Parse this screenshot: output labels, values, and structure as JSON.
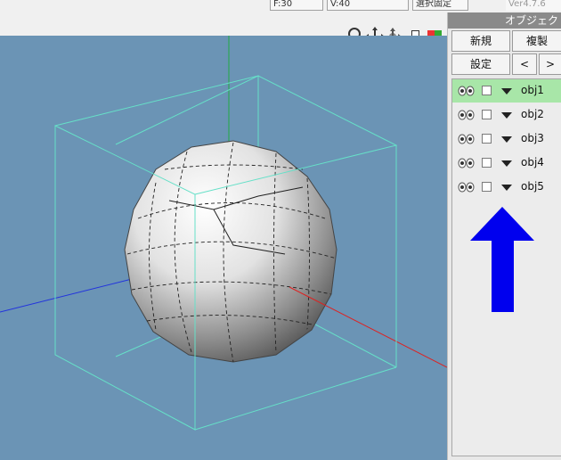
{
  "topbar": {
    "f_field": "F:30",
    "v_field": "V:40",
    "lock_button": "選択固定",
    "version": "Ver4.7.6"
  },
  "toolbar": {
    "icons": [
      "zoom-icon",
      "move-icon",
      "rotate-icon",
      "view-layout-icon",
      "color-palette-icon"
    ]
  },
  "viewport": {
    "background": "#6b94b5",
    "bounding_box_color": "#66e0c8",
    "axis_colors": {
      "x": "#dd2222",
      "y": "#22aa44",
      "z": "#2233dd"
    }
  },
  "panel": {
    "title": "オブジェクト",
    "new_label": "新規",
    "duplicate_label": "複製",
    "settings_label": "設定",
    "prev_label": "<",
    "next_label": ">",
    "objects": [
      {
        "name": "obj1",
        "selected": true
      },
      {
        "name": "obj2",
        "selected": false
      },
      {
        "name": "obj3",
        "selected": false
      },
      {
        "name": "obj4",
        "selected": false
      },
      {
        "name": "obj5",
        "selected": false
      }
    ],
    "selected_color": "#a8e6a8",
    "annotation_arrow_color": "#0000ee"
  }
}
